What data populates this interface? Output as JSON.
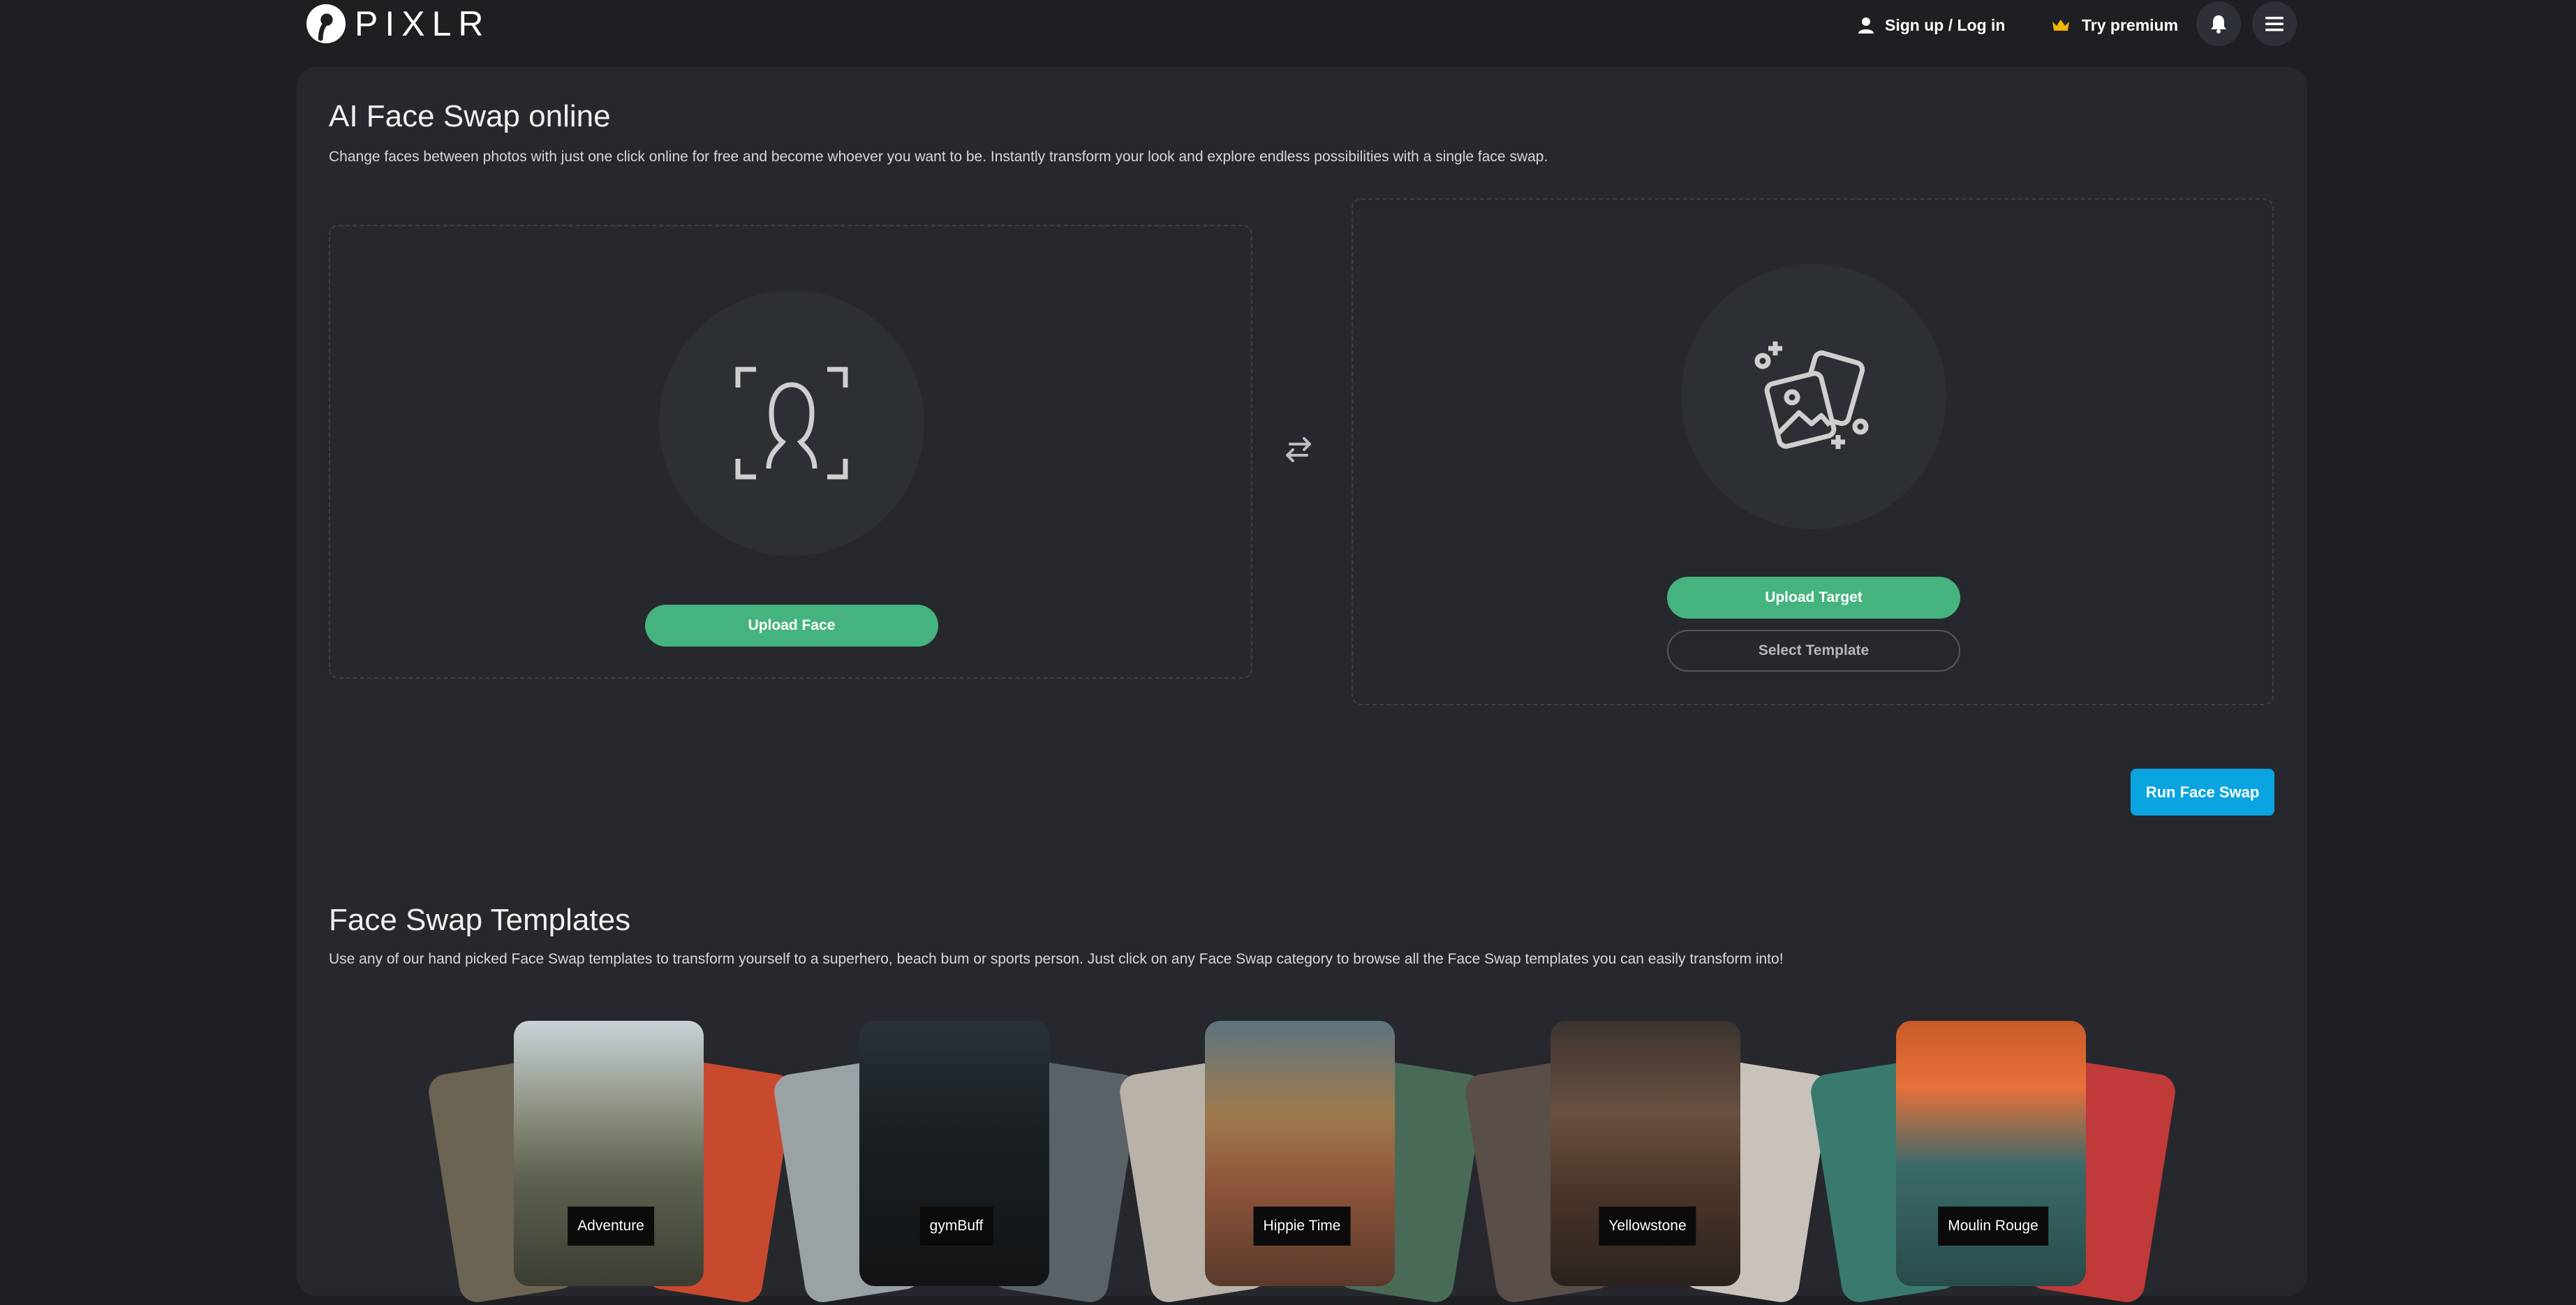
{
  "header": {
    "logo_text": "PIXLR",
    "signup_label": "Sign up / Log in",
    "premium_label": "Try premium",
    "icons": [
      "pixlr-logo-icon",
      "user-icon",
      "crown-icon",
      "bell-icon",
      "hamburger-menu-icon"
    ],
    "accent_crown": "#f1b400"
  },
  "main": {
    "title": "AI Face Swap online",
    "description": "Change faces between photos with just one click online for free and become whoever you want to be. Instantly transform your look and explore endless possibilities with a single face swap.",
    "face_panel": {
      "upload_label": "Upload Face",
      "icon": "face-scan-icon"
    },
    "swap_icon": "swap-arrows-icon",
    "target_panel": {
      "upload_label": "Upload Target",
      "template_label": "Select Template",
      "icon": "images-sparkle-icon"
    },
    "run_label": "Run Face Swap",
    "colors": {
      "green_button": "#45b37e",
      "run_button": "#0aa4e0",
      "panel_bg": "#26282d",
      "page_bg": "#1d1f23"
    }
  },
  "templates": {
    "title": "Face Swap Templates",
    "description": "Use any of our hand picked Face Swap templates to transform yourself to a superhero, beach bum or sports person. Just click on any Face Swap category to browse all the Face Swap templates you can easily transform into!",
    "items": [
      {
        "label": "Adventure",
        "front": "linear-gradient(180deg,#c9d3d8 0%,#8b8f7e 35%,#5c6150 60%,#3b3d33 100%)",
        "back_l": "#6b6453",
        "back_r": "#c84a2e"
      },
      {
        "label": "gymBuff",
        "front": "linear-gradient(180deg,#2a3238 0%,#1a1f22 40%,#121416 100%)",
        "back_l": "#9aa2a6",
        "back_r": "#5a6268"
      },
      {
        "label": "Hippie Time",
        "front": "linear-gradient(180deg,#5c7480 0%,#a07a4e 35%,#8a5238 65%,#5a3a2c 100%)",
        "back_l": "#b8b2a8",
        "back_r": "#4a6a58"
      },
      {
        "label": "Yellowstone",
        "front": "linear-gradient(180deg,#3a3330 0%,#6a5040 35%,#4a3428 65%,#2a2220 100%)",
        "back_l": "#5a4e48",
        "back_r": "#c8c2ba"
      },
      {
        "label": "Moulin Rouge",
        "front": "linear-gradient(180deg,#c85a2a 0%,#e8703a 25%,#3a6a6a 55%,#2a4a4a 100%)",
        "back_l": "#3a7a6e",
        "back_r": "#c03a3a"
      }
    ]
  }
}
